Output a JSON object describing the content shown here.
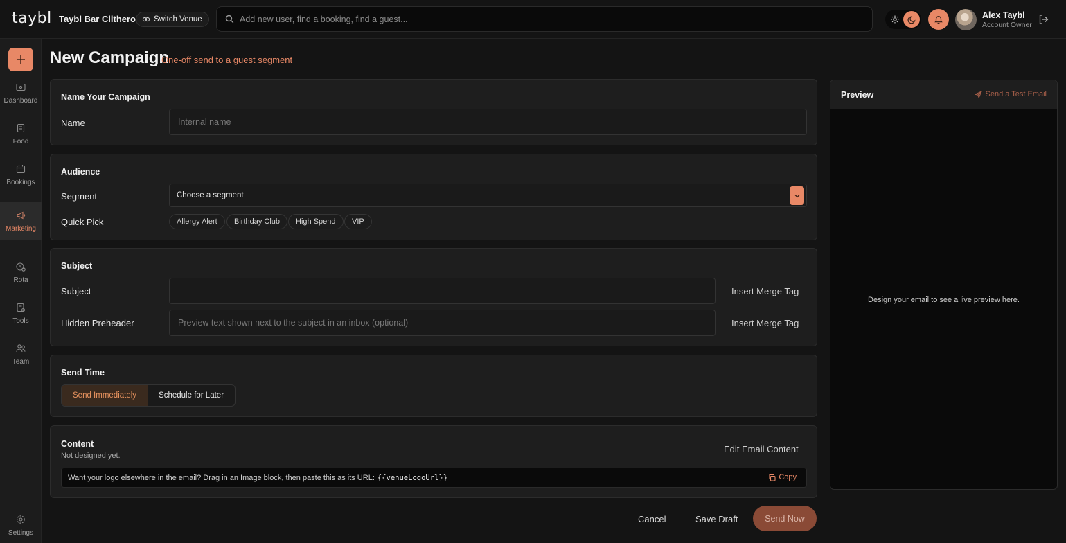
{
  "topbar": {
    "logo": "taybl",
    "venue_name": "Taybl Bar Clitheroe",
    "switch_venue_label": "Switch Venue",
    "search_placeholder": "Add new user, find a booking, find a guest...",
    "user_name": "Alex Taybl",
    "user_role": "Account Owner"
  },
  "sidebar": {
    "items": [
      {
        "label": "Dashboard",
        "icon": "dashboard-icon"
      },
      {
        "label": "Food",
        "icon": "food-icon"
      },
      {
        "label": "Bookings",
        "icon": "calendar-icon"
      },
      {
        "label": "Marketing",
        "icon": "megaphone-icon",
        "active": true
      },
      {
        "label": "Rota",
        "icon": "rota-icon"
      },
      {
        "label": "Tools",
        "icon": "tools-icon"
      },
      {
        "label": "Team",
        "icon": "team-icon"
      }
    ],
    "settings_label": "Settings"
  },
  "page": {
    "title": "New Campaign",
    "subtitle": "One-off send to a guest segment"
  },
  "name_card": {
    "title": "Name Your Campaign",
    "name_label": "Name",
    "name_placeholder": "Internal name"
  },
  "audience_card": {
    "title": "Audience",
    "segment_label": "Segment",
    "segment_value": "Choose a segment",
    "quick_pick_label": "Quick Pick",
    "quick_picks": [
      "Allergy Alert",
      "Birthday Club",
      "High Spend",
      "VIP"
    ]
  },
  "subject_card": {
    "title": "Subject",
    "subject_label": "Subject",
    "subject_value": "",
    "preheader_label": "Hidden Preheader",
    "preheader_placeholder": "Preview text shown next to the subject in an inbox (optional)",
    "merge_tag_label": "Insert Merge Tag"
  },
  "send_time_card": {
    "title": "Send Time",
    "options": [
      "Send Immediately",
      "Schedule for Later"
    ],
    "selected": "Send Immediately"
  },
  "content_card": {
    "title": "Content",
    "status": "Not designed yet.",
    "edit_label": "Edit Email Content",
    "tip_text": "Want your logo elsewhere in the email? Drag in an Image block, then paste this as its URL:",
    "tip_code": "{{venueLogoUrl}}",
    "copy_label": "Copy"
  },
  "footer": {
    "cancel_label": "Cancel",
    "save_draft_label": "Save Draft",
    "send_now_label": "Send Now"
  },
  "preview": {
    "title": "Preview",
    "send_test_label": "Send a Test Email",
    "empty_text": "Design your email to see a live preview here."
  },
  "colors": {
    "accent": "#e88866",
    "background": "#141414",
    "card": "#1e1e1e",
    "sidebar": "#1c1c1c"
  }
}
